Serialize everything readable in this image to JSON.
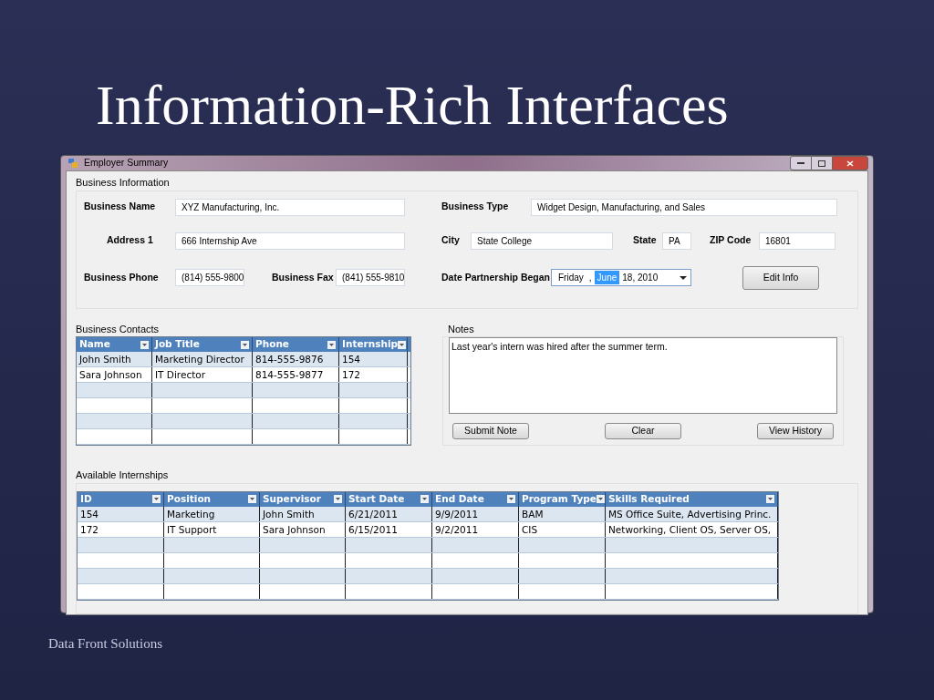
{
  "slide": {
    "title": "Information-Rich Interfaces",
    "footer": "Data Front Solutions"
  },
  "window": {
    "title": "Employer Summary"
  },
  "business_information": {
    "title": "Business Information",
    "business_name": {
      "label": "Business Name",
      "value": "XYZ Manufacturing, Inc."
    },
    "business_type": {
      "label": "Business Type",
      "value": "Widget Design, Manufacturing, and Sales"
    },
    "address_1": {
      "label": "Address 1",
      "value": "666 Internship Ave"
    },
    "city": {
      "label": "City",
      "value": "State College"
    },
    "state": {
      "label": "State",
      "value": "PA"
    },
    "zip_code": {
      "label": "ZIP Code",
      "value": "16801"
    },
    "business_phone": {
      "label": "Business Phone",
      "value": "(814) 555-9800"
    },
    "business_fax": {
      "label": "Business Fax",
      "value": "(841) 555-9810"
    },
    "date_partnership_began": {
      "label": "Date Partnership Began",
      "segments": [
        {
          "text": "Friday",
          "selected": false
        },
        {
          "text": ",",
          "selected": false
        },
        {
          "text": "June",
          "selected": true
        },
        {
          "text": "18, 2010",
          "selected": false
        }
      ]
    },
    "edit_button": "Edit Info"
  },
  "business_contacts": {
    "title": "Business Contacts",
    "columns": [
      "Name",
      "Job Title",
      "Phone",
      "Internship"
    ],
    "rows": [
      [
        "John Smith",
        "Marketing Director",
        "814-555-9876",
        "154"
      ],
      [
        "Sara Johnson",
        "IT Director",
        "814-555-9877",
        "172"
      ]
    ]
  },
  "notes": {
    "title": "Notes",
    "value": "Last year's intern was hired after the summer term.",
    "buttons": [
      "Submit Note",
      "Clear",
      "View History"
    ]
  },
  "available_internships": {
    "title": "Available Internships",
    "columns": [
      "ID",
      "Position",
      "Supervisor",
      "Start Date",
      "End Date",
      "Program Type",
      "Skills Required"
    ],
    "rows": [
      [
        "154",
        "Marketing",
        "John Smith",
        "6/21/2011",
        "9/9/2011",
        "BAM",
        "MS Office Suite, Advertising Princ."
      ],
      [
        "172",
        "IT Support",
        "Sara Johnson",
        "6/15/2011",
        "9/2/2011",
        "CIS",
        "Networking, Client OS, Server OS,"
      ]
    ]
  }
}
